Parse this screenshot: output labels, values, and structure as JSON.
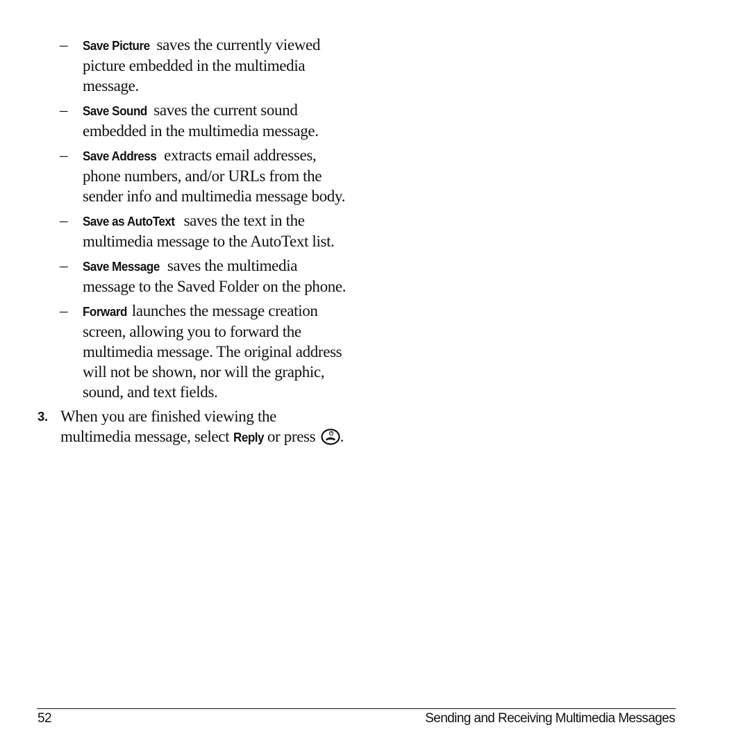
{
  "items": [
    {
      "label": "Save Picture",
      "text": " saves the currently viewed picture embedded in the multimedia message."
    },
    {
      "label": "Save Sound",
      "text": " saves the current sound embedded in the multimedia message."
    },
    {
      "label": "Save Address",
      "text": " extracts email addresses, phone numbers, and/or URLs from the sender info and multimedia message body."
    },
    {
      "label": "Save as AutoText",
      "text": " saves the text in the multimedia message to the AutoText list."
    },
    {
      "label": "Save Message",
      "text": " saves the multimedia message to the Saved Folder on the phone."
    },
    {
      "label": "Forward",
      "text": " launches the message creation screen, allowing you to forward the multimedia message. The original address will not be shown, nor will the graphic, sound, and text fields."
    }
  ],
  "bullet": "–",
  "step3": {
    "number": "3.",
    "text_before": "When you are finished viewing the multimedia message, select ",
    "label": "Reply",
    "text_middle": " or press ",
    "icon": "end-key-icon",
    "text_after": "."
  },
  "footer": {
    "page_number": "52",
    "section_title": "Sending and Receiving Multimedia Messages"
  }
}
